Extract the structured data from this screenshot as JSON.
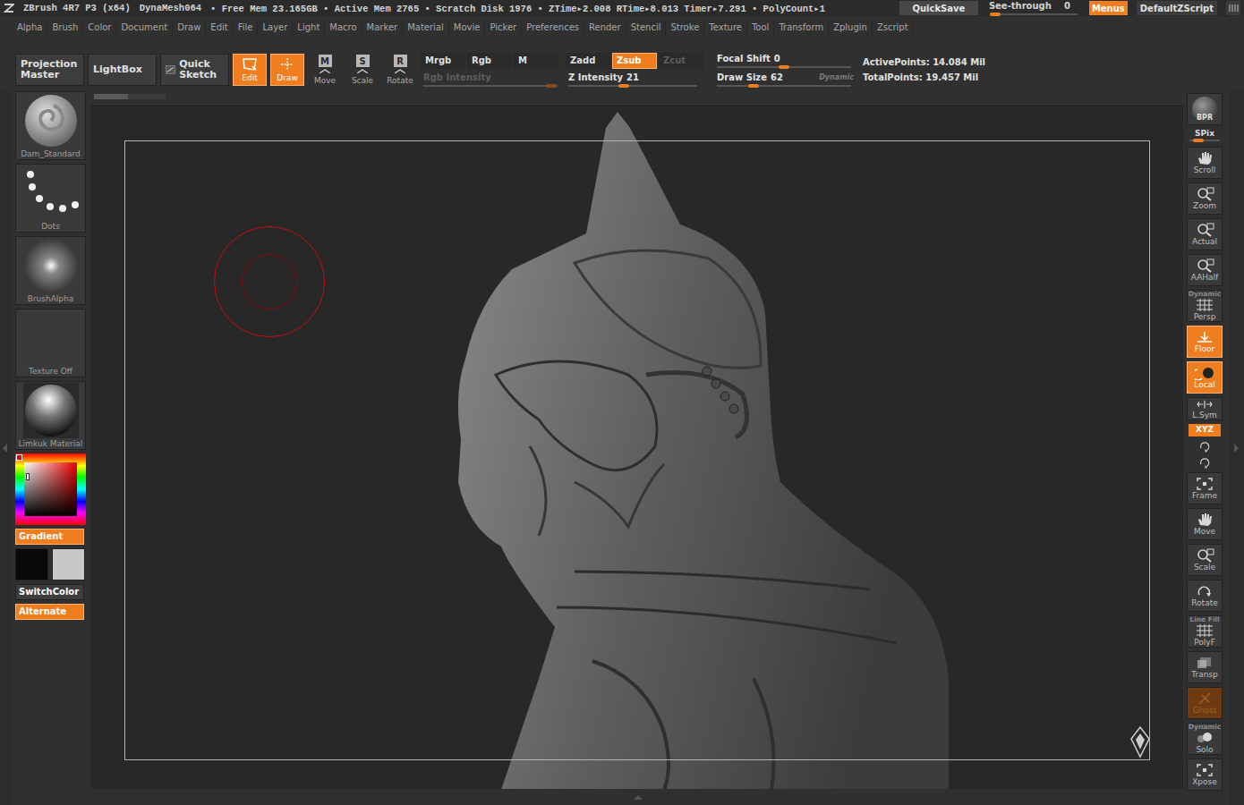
{
  "title_bar": {
    "app": "ZBrush 4R7 P3 (x64)",
    "tool": "DynaMesh064",
    "stats": "• Free Mem 23.165GB • Active Mem 2765 • Scratch Disk 1976 • ZTime▸2.008 RTime▸8.013 Timer▸7.291 • PolyCount▸1",
    "quicksave": "QuickSave",
    "see_through": {
      "label": "See-through",
      "value": "0",
      "level": 0
    },
    "menus": {
      "label": "Menus",
      "on": true
    },
    "script": "DefaultZScript"
  },
  "menu_bar": [
    "Alpha",
    "Brush",
    "Color",
    "Document",
    "Draw",
    "Edit",
    "File",
    "Layer",
    "Light",
    "Macro",
    "Marker",
    "Material",
    "Movie",
    "Picker",
    "Preferences",
    "Render",
    "Stencil",
    "Stroke",
    "Texture",
    "Tool",
    "Transform",
    "Zplugin",
    "Zscript"
  ],
  "shelf": {
    "projection_master": "Projection Master",
    "lightbox": "LightBox",
    "quick_sketch": "Quick Sketch",
    "transform_modes": [
      {
        "label": "Edit",
        "on": true,
        "kind": "edit"
      },
      {
        "label": "Draw",
        "on": true,
        "kind": "draw"
      },
      {
        "label": "Move",
        "key": "M",
        "on": false,
        "kind": "move"
      },
      {
        "label": "Scale",
        "key": "S",
        "on": false,
        "kind": "scale"
      },
      {
        "label": "Rotate",
        "key": "R",
        "on": false,
        "kind": "rotate"
      }
    ],
    "color_modes": [
      {
        "label": "Mrgb",
        "selected": false,
        "disabled": false
      },
      {
        "label": "Rgb",
        "selected": false,
        "disabled": false
      },
      {
        "label": "M",
        "selected": false,
        "disabled": false
      }
    ],
    "depth_modes": [
      {
        "label": "Zadd",
        "selected": false,
        "disabled": false
      },
      {
        "label": "Zsub",
        "selected": true,
        "disabled": false
      },
      {
        "label": "Zcut",
        "selected": false,
        "disabled": true
      }
    ],
    "rgb_intensity": {
      "label": "Rgb Intensity",
      "level": 0.95,
      "disabled": true
    },
    "z_intensity": {
      "label": "Z Intensity",
      "value": "21",
      "level": 0.43,
      "disabled": false
    },
    "focal_shift": {
      "label": "Focal Shift",
      "value": "0",
      "level": 0.5,
      "disabled": false
    },
    "draw_size": {
      "label": "Draw Size",
      "value": "62",
      "level": 0.27,
      "disabled": false,
      "suffix": "Dynamic"
    },
    "points": [
      "ActivePoints: 14.084 Mil",
      "TotalPoints: 19.457 Mil"
    ]
  },
  "left_shelf": {
    "slots": [
      {
        "label": "Dam_Standard",
        "kind": "brush"
      },
      {
        "label": "Dots",
        "kind": "stroke"
      },
      {
        "label": "BrushAlpha",
        "kind": "alpha"
      },
      {
        "label": "Texture Off",
        "kind": "texture"
      },
      {
        "label": "Limkuk Material",
        "kind": "material"
      }
    ],
    "gradient": {
      "label": "Gradient",
      "on": true
    },
    "primary_color": "#0a0a0a",
    "secondary_color": "#c8c8c8",
    "switch_color": "SwitchColor",
    "alternate": {
      "label": "Alternate",
      "on": true
    }
  },
  "right_shelf": [
    {
      "label": "BPR",
      "kind": "bpr",
      "on": false,
      "disabled": false
    },
    {
      "label": "SPix",
      "kind": "slider",
      "on": false,
      "disabled": false,
      "level": 0.3
    },
    {
      "label": "Scroll",
      "kind": "hand",
      "on": false,
      "disabled": false
    },
    {
      "label": "Zoom",
      "kind": "zoom",
      "on": false,
      "disabled": false
    },
    {
      "label": "Actual",
      "kind": "zoom",
      "on": false,
      "disabled": false
    },
    {
      "label": "AAHalf",
      "kind": "zoom",
      "on": false,
      "disabled": false
    },
    {
      "label": "Persp",
      "top": "Dynamic",
      "kind": "grid",
      "on": false,
      "disabled": false
    },
    {
      "label": "Floor",
      "kind": "floor",
      "on": true,
      "disabled": false
    },
    {
      "label": "Local",
      "kind": "local",
      "on": true,
      "disabled": false
    },
    {
      "label": "L.Sym",
      "kind": "lsym",
      "on": false,
      "disabled": false
    },
    {
      "label": "XYZ",
      "kind": "xyz",
      "on": true,
      "disabled": false
    },
    {
      "kind": "rot",
      "on": false,
      "disabled": false
    },
    {
      "kind": "rot",
      "on": false,
      "disabled": false
    },
    {
      "label": "Frame",
      "kind": "frame",
      "on": false,
      "disabled": false
    },
    {
      "label": "Move",
      "kind": "hand",
      "on": false,
      "disabled": false
    },
    {
      "label": "Scale",
      "kind": "zoom",
      "on": false,
      "disabled": false
    },
    {
      "label": "Rotate",
      "kind": "rotate",
      "on": false,
      "disabled": false
    },
    {
      "label": "PolyF",
      "top": "Line Fill",
      "kind": "grid",
      "on": false,
      "disabled": false
    },
    {
      "label": "Transp",
      "kind": "transp",
      "on": false,
      "disabled": false
    },
    {
      "label": "Ghost",
      "kind": "ghost",
      "on": true,
      "disabled": true
    },
    {
      "label": "Solo",
      "top": "Dynamic",
      "kind": "solo",
      "on": false,
      "disabled": false
    },
    {
      "label": "Xpose",
      "kind": "frame",
      "on": false,
      "disabled": false
    }
  ]
}
